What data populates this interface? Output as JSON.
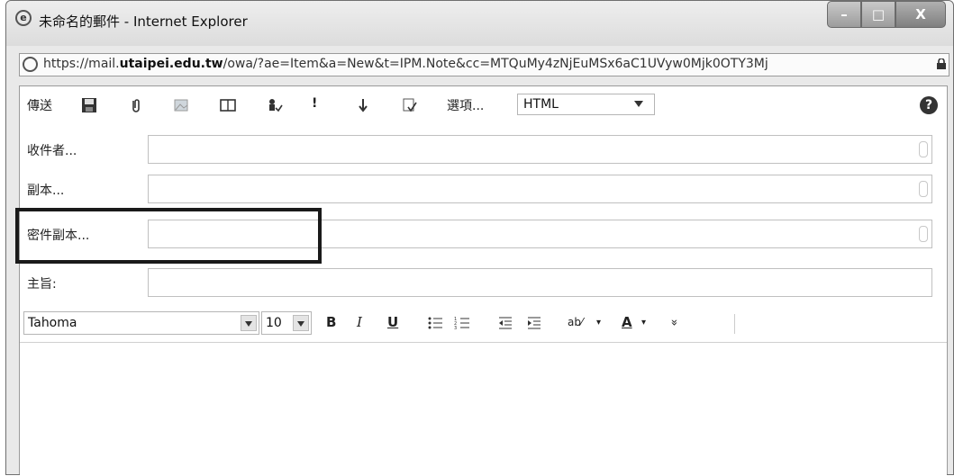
{
  "window": {
    "title": "未命名的郵件 - Internet Explorer",
    "minimize_label": "–",
    "maximize_label": "□",
    "close_label": "X"
  },
  "address_bar": {
    "url_prefix": "https://mail.",
    "url_domain": "utaipei.edu.tw",
    "url_rest": "/owa/?ae=Item&a=New&t=IPM.Note&cc=MTQuMy4zNjEuMSx6aC1UVyw0Mjk0OTY3Mj"
  },
  "toolbar": {
    "send_label": "傳送",
    "options_label": "選項...",
    "format_value": "HTML",
    "help_label": "?"
  },
  "fields": {
    "to_label": "收件者...",
    "cc_label": "副本...",
    "bcc_label": "密件副本...",
    "subject_label": "主旨:"
  },
  "format_bar": {
    "font_value": "Tahoma",
    "size_value": "10",
    "bold_label": "B",
    "italic_label": "I",
    "underline_label": "U",
    "highlight_label": "ab⁄",
    "font_color_label": "A",
    "more_label": "»"
  },
  "colors": {
    "highlight_box": "#1a1a1a"
  }
}
